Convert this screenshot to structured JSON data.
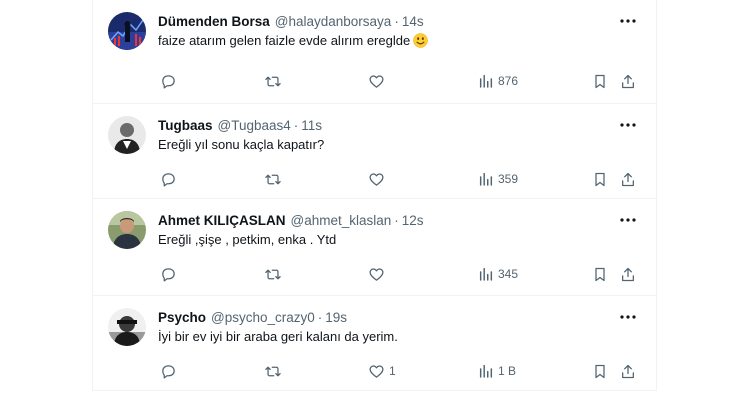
{
  "tweets": [
    {
      "name": "Dümenden Borsa",
      "handle": "@halaydanborsaya",
      "dot": "·",
      "time": "14s",
      "text": "faize atarım gelen faizle evde alırım ereglde",
      "emoji": "smiling-face-emoji",
      "replies": "",
      "retweets": "",
      "likes": "",
      "views": "876"
    },
    {
      "name": "Tugbaas",
      "handle": "@Tugbaas4",
      "dot": "·",
      "time": "11s",
      "text": "Ereğli yıl sonu kaçla kapatır?",
      "replies": "",
      "retweets": "",
      "likes": "",
      "views": "359"
    },
    {
      "name": "Ahmet KILIÇASLAN",
      "handle": "@ahmet_klaslan",
      "dot": "·",
      "time": "12s",
      "text": "Ereğli ,şişe , petkim, enka . Ytd",
      "replies": "",
      "retweets": "",
      "likes": "",
      "views": "345"
    },
    {
      "name": "Psycho",
      "handle": "@psycho_crazy0",
      "dot": "·",
      "time": "19s",
      "text": "İyi bir ev iyi bir araba geri kalanı da yerim.",
      "replies": "",
      "retweets": "",
      "likes": "1",
      "views": "1 B"
    }
  ],
  "icons": {
    "more": "more-dots-icon",
    "reply": "reply-icon",
    "retweet": "retweet-icon",
    "like": "like-icon",
    "views": "views-icon",
    "bookmark": "bookmark-icon",
    "share": "share-icon"
  },
  "colors": {
    "text": "#0f1419",
    "secondary": "#536471",
    "border": "#eff3f4"
  }
}
